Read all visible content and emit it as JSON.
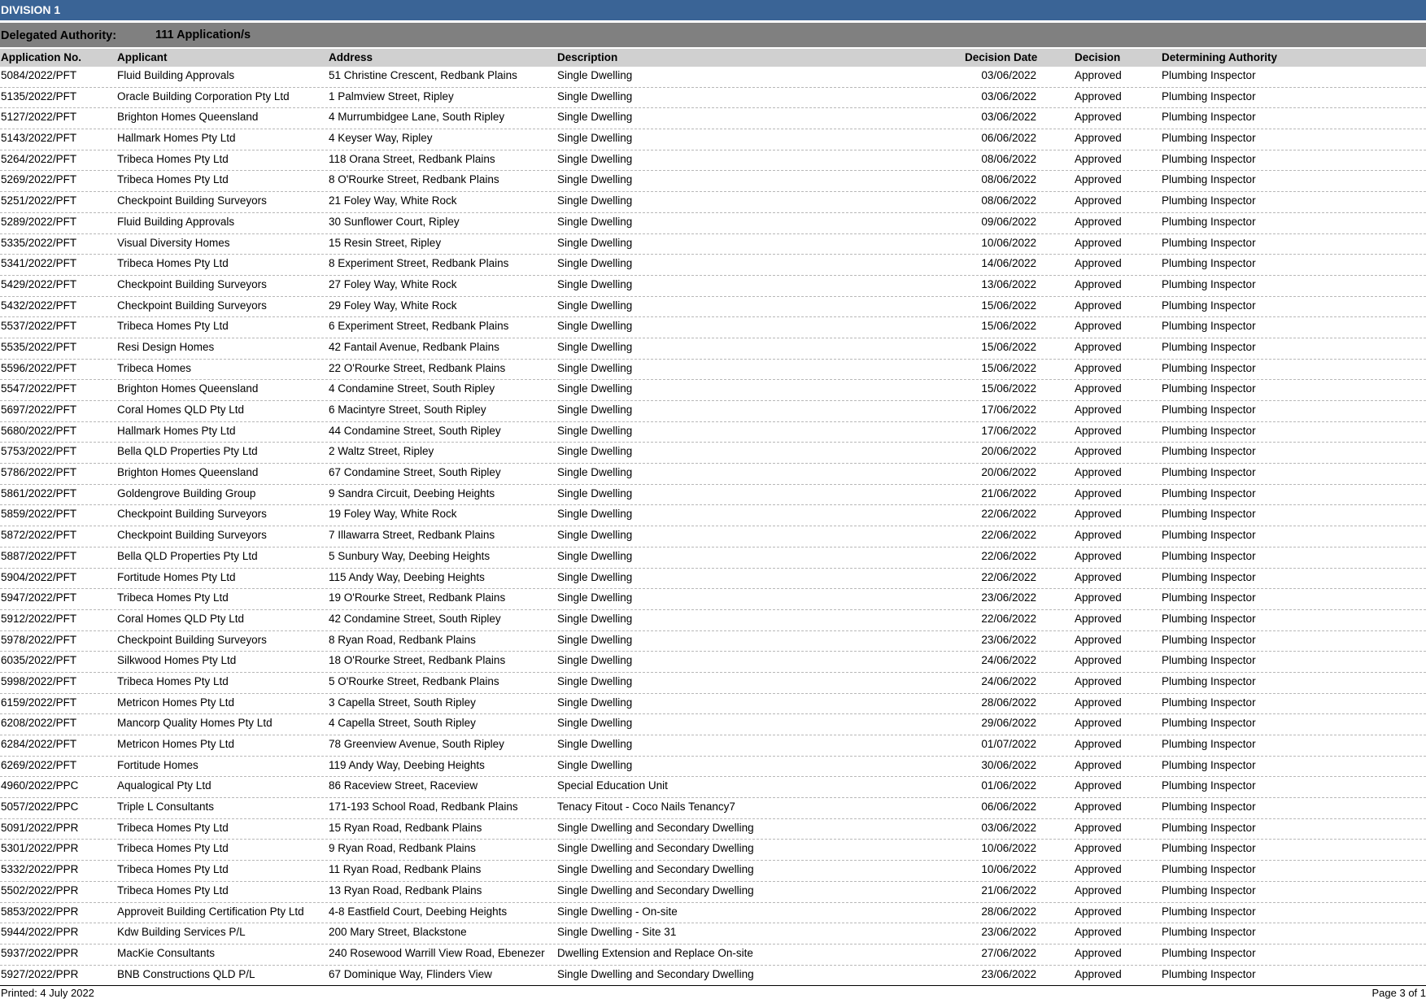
{
  "division": {
    "title": "DIVISION 1"
  },
  "authority": {
    "label": "Delegated Authority:",
    "count": "111 Application/s"
  },
  "columns": {
    "app_no": "Application No.",
    "applicant": "Applicant",
    "address": "Address",
    "description": "Description",
    "decision_date": "Decision Date",
    "decision": "Decision",
    "authority": "Determining Authority"
  },
  "rows": [
    [
      "5084/2022/PFT",
      "Fluid Building Approvals",
      "51 Christine Crescent, Redbank Plains",
      "Single Dwelling",
      "03/06/2022",
      "Approved",
      "Plumbing Inspector"
    ],
    [
      "5135/2022/PFT",
      "Oracle Building Corporation Pty Ltd",
      "1 Palmview Street, Ripley",
      "Single Dwelling",
      "03/06/2022",
      "Approved",
      "Plumbing Inspector"
    ],
    [
      "5127/2022/PFT",
      "Brighton Homes Queensland",
      "4 Murrumbidgee Lane, South Ripley",
      "Single Dwelling",
      "03/06/2022",
      "Approved",
      "Plumbing Inspector"
    ],
    [
      "5143/2022/PFT",
      "Hallmark Homes Pty Ltd",
      "4 Keyser Way, Ripley",
      "Single Dwelling",
      "06/06/2022",
      "Approved",
      "Plumbing Inspector"
    ],
    [
      "5264/2022/PFT",
      "Tribeca Homes Pty Ltd",
      "118 Orana Street, Redbank Plains",
      "Single Dwelling",
      "08/06/2022",
      "Approved",
      "Plumbing Inspector"
    ],
    [
      "5269/2022/PFT",
      "Tribeca Homes Pty Ltd",
      "8 O'Rourke Street, Redbank Plains",
      "Single Dwelling",
      "08/06/2022",
      "Approved",
      "Plumbing Inspector"
    ],
    [
      "5251/2022/PFT",
      "Checkpoint Building Surveyors",
      "21 Foley Way, White Rock",
      "Single Dwelling",
      "08/06/2022",
      "Approved",
      "Plumbing Inspector"
    ],
    [
      "5289/2022/PFT",
      "Fluid Building Approvals",
      "30 Sunflower Court, Ripley",
      "Single Dwelling",
      "09/06/2022",
      "Approved",
      "Plumbing Inspector"
    ],
    [
      "5335/2022/PFT",
      "Visual Diversity Homes",
      "15 Resin Street, Ripley",
      "Single Dwelling",
      "10/06/2022",
      "Approved",
      "Plumbing Inspector"
    ],
    [
      "5341/2022/PFT",
      "Tribeca Homes Pty Ltd",
      "8 Experiment Street, Redbank Plains",
      "Single Dwelling",
      "14/06/2022",
      "Approved",
      "Plumbing Inspector"
    ],
    [
      "5429/2022/PFT",
      "Checkpoint Building Surveyors",
      "27 Foley Way, White Rock",
      "Single Dwelling",
      "13/06/2022",
      "Approved",
      "Plumbing Inspector"
    ],
    [
      "5432/2022/PFT",
      "Checkpoint Building Surveyors",
      "29 Foley Way, White Rock",
      "Single Dwelling",
      "15/06/2022",
      "Approved",
      "Plumbing Inspector"
    ],
    [
      "5537/2022/PFT",
      "Tribeca Homes Pty Ltd",
      "6 Experiment Street, Redbank Plains",
      "Single Dwelling",
      "15/06/2022",
      "Approved",
      "Plumbing Inspector"
    ],
    [
      "5535/2022/PFT",
      "Resi Design Homes",
      "42 Fantail Avenue, Redbank Plains",
      "Single Dwelling",
      "15/06/2022",
      "Approved",
      "Plumbing Inspector"
    ],
    [
      "5596/2022/PFT",
      "Tribeca Homes",
      "22 O'Rourke Street, Redbank Plains",
      "Single Dwelling",
      "15/06/2022",
      "Approved",
      "Plumbing Inspector"
    ],
    [
      "5547/2022/PFT",
      "Brighton Homes Queensland",
      "4 Condamine Street, South Ripley",
      "Single Dwelling",
      "15/06/2022",
      "Approved",
      "Plumbing Inspector"
    ],
    [
      "5697/2022/PFT",
      "Coral Homes QLD Pty Ltd",
      "6 Macintyre Street, South Ripley",
      "Single Dwelling",
      "17/06/2022",
      "Approved",
      "Plumbing Inspector"
    ],
    [
      "5680/2022/PFT",
      "Hallmark Homes Pty Ltd",
      "44 Condamine Street, South Ripley",
      "Single Dwelling",
      "17/06/2022",
      "Approved",
      "Plumbing Inspector"
    ],
    [
      "5753/2022/PFT",
      "Bella QLD Properties Pty Ltd",
      "2 Waltz Street, Ripley",
      "Single Dwelling",
      "20/06/2022",
      "Approved",
      "Plumbing Inspector"
    ],
    [
      "5786/2022/PFT",
      "Brighton Homes Queensland",
      "67 Condamine Street, South Ripley",
      "Single Dwelling",
      "20/06/2022",
      "Approved",
      "Plumbing Inspector"
    ],
    [
      "5861/2022/PFT",
      "Goldengrove Building Group",
      "9 Sandra Circuit, Deebing Heights",
      "Single Dwelling",
      "21/06/2022",
      "Approved",
      "Plumbing Inspector"
    ],
    [
      "5859/2022/PFT",
      "Checkpoint Building Surveyors",
      "19 Foley Way, White Rock",
      "Single Dwelling",
      "22/06/2022",
      "Approved",
      "Plumbing Inspector"
    ],
    [
      "5872/2022/PFT",
      "Checkpoint Building Surveyors",
      "7 Illawarra Street, Redbank Plains",
      "Single Dwelling",
      "22/06/2022",
      "Approved",
      "Plumbing Inspector"
    ],
    [
      "5887/2022/PFT",
      "Bella QLD Properties Pty Ltd",
      "5 Sunbury Way, Deebing Heights",
      "Single Dwelling",
      "22/06/2022",
      "Approved",
      "Plumbing Inspector"
    ],
    [
      "5904/2022/PFT",
      "Fortitude Homes Pty Ltd",
      "115 Andy Way, Deebing Heights",
      "Single Dwelling",
      "22/06/2022",
      "Approved",
      "Plumbing Inspector"
    ],
    [
      "5947/2022/PFT",
      "Tribeca Homes Pty Ltd",
      "19 O'Rourke Street, Redbank Plains",
      "Single Dwelling",
      "23/06/2022",
      "Approved",
      "Plumbing Inspector"
    ],
    [
      "5912/2022/PFT",
      "Coral Homes QLD Pty Ltd",
      "42 Condamine Street, South Ripley",
      "Single Dwelling",
      "22/06/2022",
      "Approved",
      "Plumbing Inspector"
    ],
    [
      "5978/2022/PFT",
      "Checkpoint Building Surveyors",
      "8 Ryan Road, Redbank Plains",
      "Single Dwelling",
      "23/06/2022",
      "Approved",
      "Plumbing Inspector"
    ],
    [
      "6035/2022/PFT",
      "Silkwood Homes Pty Ltd",
      "18 O'Rourke Street, Redbank Plains",
      "Single Dwelling",
      "24/06/2022",
      "Approved",
      "Plumbing Inspector"
    ],
    [
      "5998/2022/PFT",
      "Tribeca Homes Pty Ltd",
      "5 O'Rourke Street, Redbank Plains",
      "Single Dwelling",
      "24/06/2022",
      "Approved",
      "Plumbing Inspector"
    ],
    [
      "6159/2022/PFT",
      "Metricon Homes Pty Ltd",
      "3 Capella Street, South Ripley",
      "Single Dwelling",
      "28/06/2022",
      "Approved",
      "Plumbing Inspector"
    ],
    [
      "6208/2022/PFT",
      "Mancorp Quality Homes Pty Ltd",
      "4 Capella Street, South Ripley",
      "Single Dwelling",
      "29/06/2022",
      "Approved",
      "Plumbing Inspector"
    ],
    [
      "6284/2022/PFT",
      "Metricon Homes Pty Ltd",
      "78 Greenview Avenue, South Ripley",
      "Single Dwelling",
      "01/07/2022",
      "Approved",
      "Plumbing Inspector"
    ],
    [
      "6269/2022/PFT",
      "Fortitude Homes",
      "119 Andy Way, Deebing Heights",
      "Single Dwelling",
      "30/06/2022",
      "Approved",
      "Plumbing Inspector"
    ],
    [
      "4960/2022/PPC",
      "Aqualogical Pty Ltd",
      "86 Raceview Street, Raceview",
      "Special Education Unit",
      "01/06/2022",
      "Approved",
      "Plumbing Inspector"
    ],
    [
      "5057/2022/PPC",
      "Triple L Consultants",
      "171-193 School Road, Redbank Plains",
      "Tenacy Fitout - Coco Nails Tenancy7",
      "06/06/2022",
      "Approved",
      "Plumbing Inspector"
    ],
    [
      "5091/2022/PPR",
      "Tribeca Homes Pty Ltd",
      "15 Ryan Road, Redbank Plains",
      "Single Dwelling and Secondary Dwelling",
      "03/06/2022",
      "Approved",
      "Plumbing Inspector"
    ],
    [
      "5301/2022/PPR",
      "Tribeca Homes Pty Ltd",
      "9 Ryan Road, Redbank Plains",
      "Single Dwelling and Secondary Dwelling",
      "10/06/2022",
      "Approved",
      "Plumbing Inspector"
    ],
    [
      "5332/2022/PPR",
      "Tribeca Homes Pty Ltd",
      "11 Ryan Road, Redbank Plains",
      "Single Dwelling and Secondary Dwelling",
      "10/06/2022",
      "Approved",
      "Plumbing Inspector"
    ],
    [
      "5502/2022/PPR",
      "Tribeca Homes Pty Ltd",
      "13 Ryan Road, Redbank Plains",
      "Single Dwelling and Secondary Dwelling",
      "21/06/2022",
      "Approved",
      "Plumbing Inspector"
    ],
    [
      "5853/2022/PPR",
      "Approveit Building Certification Pty Ltd",
      "4-8 Eastfield Court, Deebing Heights",
      "Single Dwelling - On-site",
      "28/06/2022",
      "Approved",
      "Plumbing Inspector"
    ],
    [
      "5944/2022/PPR",
      "Kdw Building Services P/L",
      "200 Mary Street, Blackstone",
      "Single Dwelling - Site 31",
      "23/06/2022",
      "Approved",
      "Plumbing Inspector"
    ],
    [
      "5937/2022/PPR",
      "MacKie Consultants",
      "240 Rosewood Warrill View Road, Ebenezer",
      "Dwelling Extension and Replace On-site",
      "27/06/2022",
      "Approved",
      "Plumbing Inspector"
    ],
    [
      "5927/2022/PPR",
      "BNB Constructions QLD P/L",
      "67 Dominique Way, Flinders View",
      "Single Dwelling and Secondary Dwelling",
      "23/06/2022",
      "Approved",
      "Plumbing Inspector"
    ]
  ],
  "footer": {
    "printed": "Printed: 4 July 2022",
    "page": "Page 3 of 1"
  },
  "colors": {
    "division_bar": "#3a6496",
    "authority_bar": "#808080",
    "header_row": "#d0d0d0"
  }
}
